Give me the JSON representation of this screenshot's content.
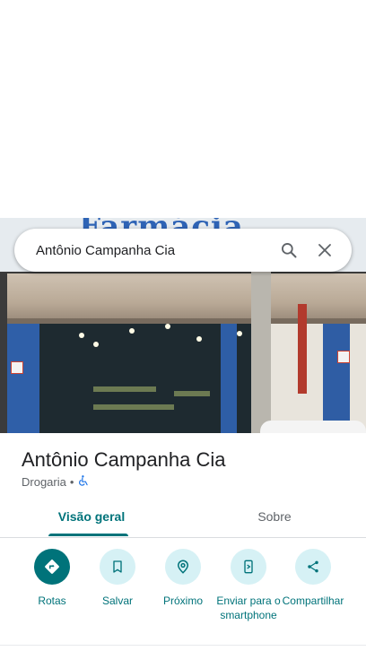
{
  "search": {
    "value": "Antônio Campanha Cia",
    "search_icon": "search-icon",
    "clear_icon": "close-icon"
  },
  "photo": {
    "sign_text": "Farmácia"
  },
  "place": {
    "name": "Antônio Campanha Cia",
    "category": "Drogaria",
    "separator": "•",
    "accessibility_icon": "wheelchair-icon"
  },
  "tabs": [
    {
      "label": "Visão geral",
      "active": true
    },
    {
      "label": "Sobre",
      "active": false
    }
  ],
  "actions": [
    {
      "label": "Rotas",
      "icon": "directions-icon"
    },
    {
      "label": "Salvar",
      "icon": "bookmark-icon"
    },
    {
      "label": "Próximo",
      "icon": "nearby-icon"
    },
    {
      "label": "Enviar para o smartphone",
      "icon": "send-to-phone-icon"
    },
    {
      "label": "Compartilhar",
      "icon": "share-icon"
    }
  ],
  "colors": {
    "accent": "#00737a",
    "action_bg": "#d6f1f5",
    "accessibility": "#1a73e8"
  }
}
